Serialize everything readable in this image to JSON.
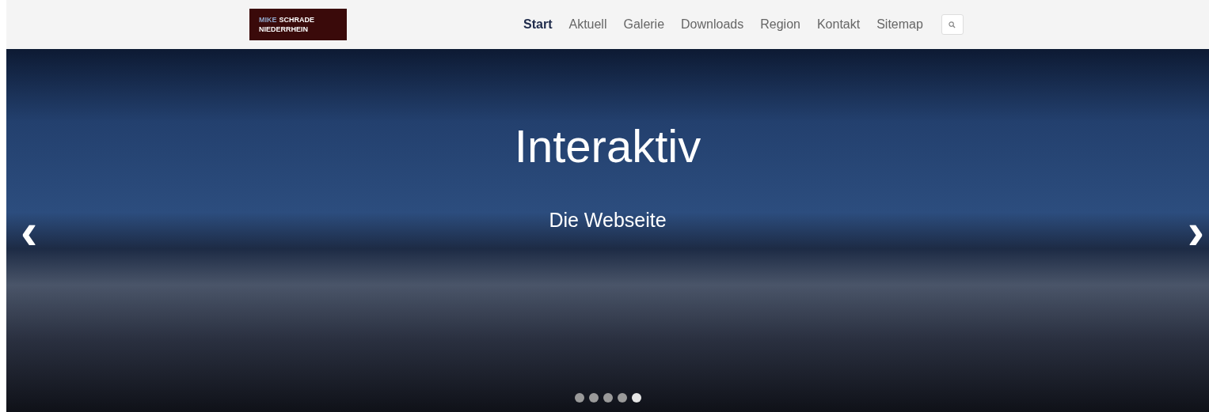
{
  "logo": {
    "line_1": [
      {
        "text": "MIKE",
        "accent": true
      },
      {
        "text": "SCHRADE",
        "accent": false
      }
    ],
    "line_2": "NIEDERRHEIN"
  },
  "nav": [
    {
      "label": "Start",
      "selected": true
    },
    {
      "label": "Aktuell",
      "selected": false
    },
    {
      "label": "Galerie",
      "selected": false
    },
    {
      "label": "Downloads",
      "selected": false
    },
    {
      "label": "Region",
      "selected": false
    },
    {
      "label": "Kontakt",
      "selected": false
    },
    {
      "label": "Sitemap",
      "selected": false
    }
  ],
  "hero": {
    "title": "Interaktiv",
    "subtitle": "Die Webseite",
    "prev": "‹",
    "next": "›",
    "dots": [
      {
        "selected": false
      },
      {
        "selected": false
      },
      {
        "selected": false
      },
      {
        "selected": false
      },
      {
        "selected": true
      }
    ]
  }
}
